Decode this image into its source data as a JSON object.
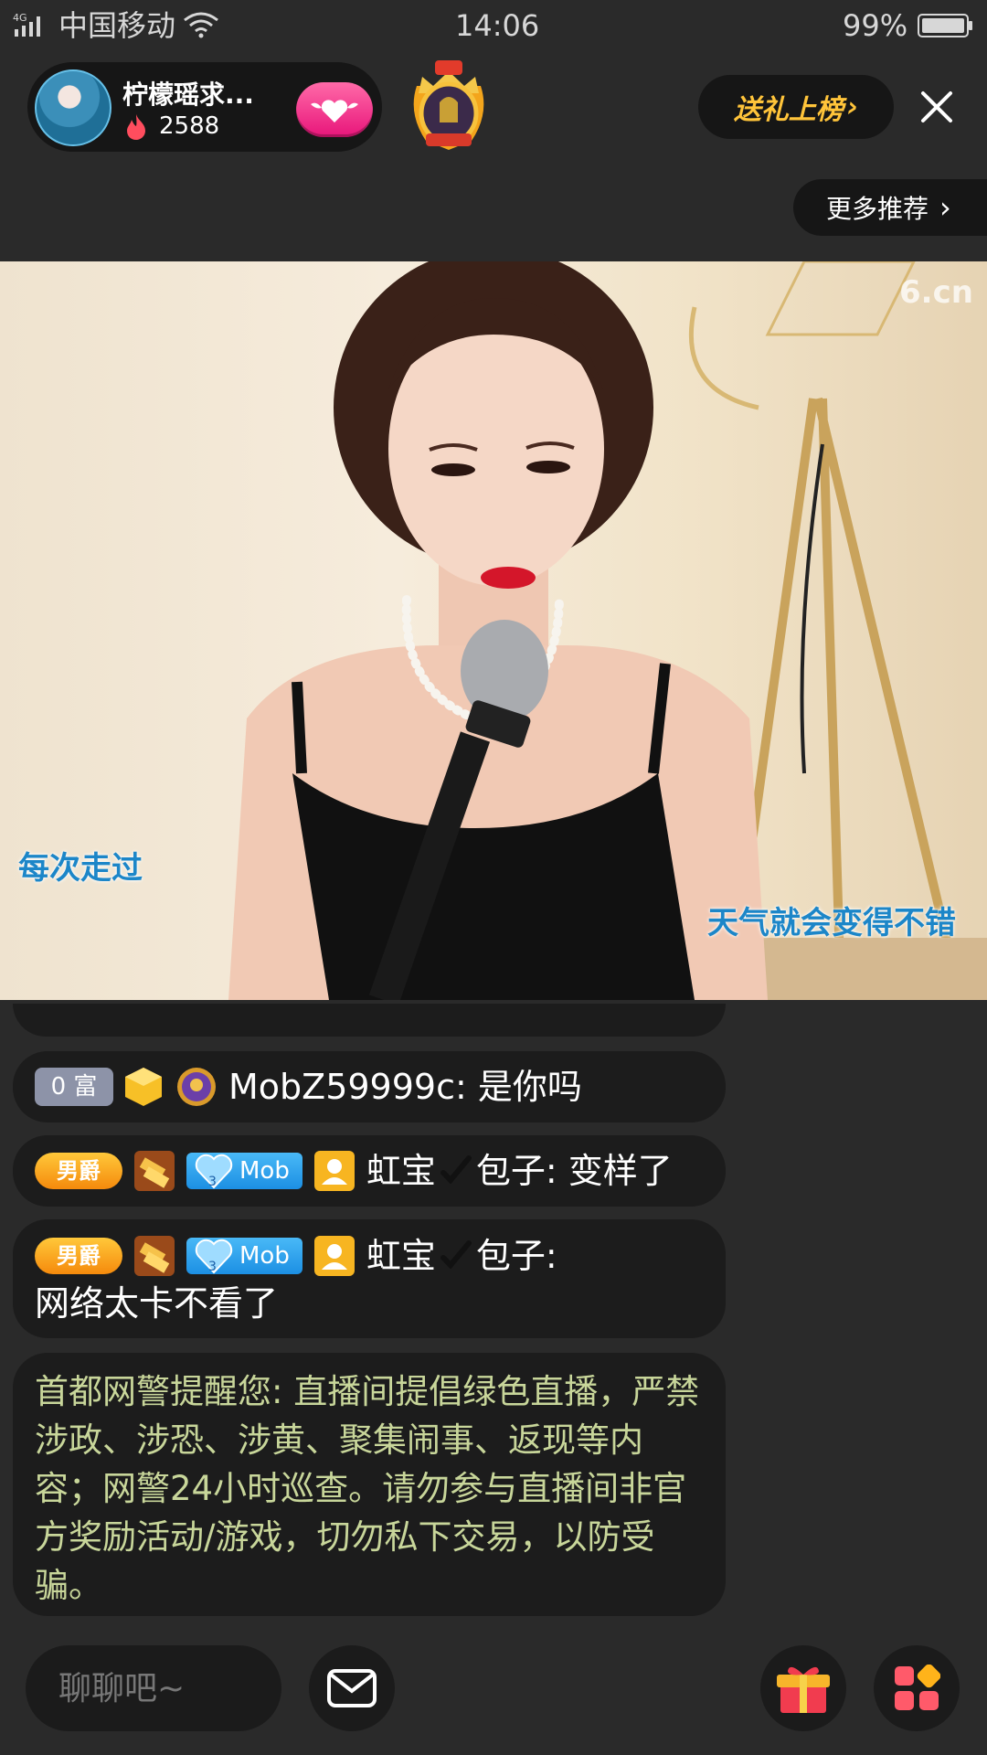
{
  "status_bar": {
    "network": "4G",
    "carrier": "中国移动",
    "time": "14:06",
    "battery": "99%"
  },
  "host": {
    "name": "柠檬瑶求...",
    "heat": "2588",
    "icons": [
      "avatar",
      "flame-icon",
      "heart-wings-icon",
      "guard-badge-icon"
    ]
  },
  "top_actions": {
    "gift_rank_label": "送礼上榜",
    "more_recommend_label": "更多推荐"
  },
  "video": {
    "watermark": "6.cn",
    "lyric_left": "每次走过",
    "lyric_right": "天气就会变得不错"
  },
  "chat": {
    "partial_top": "",
    "messages": [
      {
        "badges": [
          "0 富",
          "gold-cube-icon",
          "purple-medal-icon"
        ],
        "rich_label": "0 富",
        "user": "MobZ59999c",
        "text": "是你吗"
      },
      {
        "baron_label": "男爵",
        "mob_label": "Mob",
        "level": "3",
        "user_pre": "虹宝",
        "user_post": "包子",
        "text": "变样了"
      },
      {
        "baron_label": "男爵",
        "mob_label": "Mob",
        "level": "3",
        "user_pre": "虹宝",
        "user_post": "包子",
        "text": "网络太卡不看了"
      }
    ],
    "notice": "首都网警提醒您: 直播间提倡绿色直播，严禁涉政、涉恐、涉黄、聚集闹事、返现等内容；网警24小时巡查。请勿参与直播间非官方奖励活动/游戏，切勿私下交易，以防受骗。"
  },
  "bottom_bar": {
    "input_placeholder": "聊聊吧~",
    "icons": [
      "mail-icon",
      "gift-icon",
      "apps-grid-icon"
    ]
  },
  "colors": {
    "background": "#2a2a2a",
    "pill_bg": "#161616",
    "gift_rank_text": "#ffc43a",
    "notice_text": "#c8d69a",
    "follow_pink": "#e8157a",
    "mob_blue": "#1c8fe3",
    "baron_orange": "#f58a0c"
  }
}
